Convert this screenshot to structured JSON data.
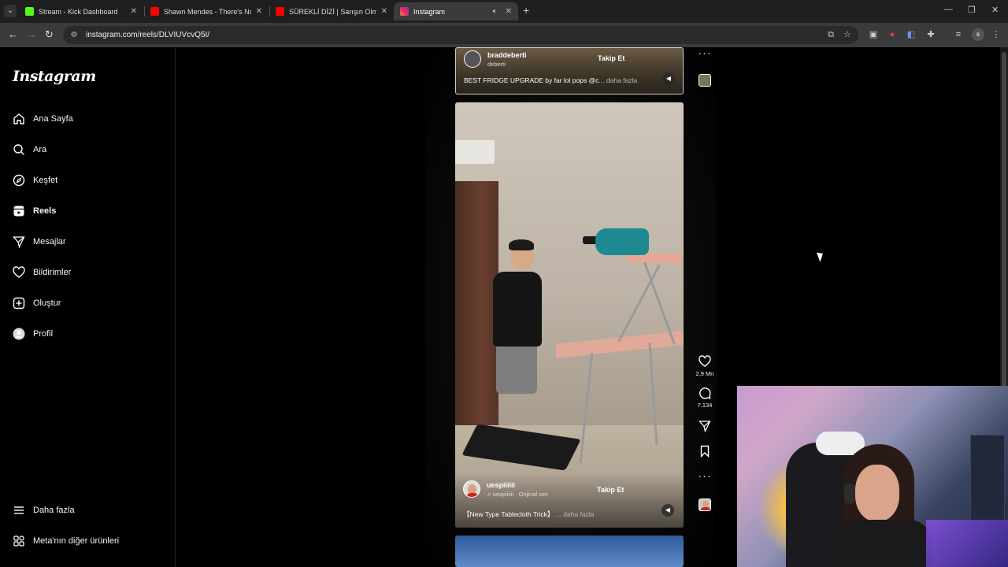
{
  "browser": {
    "tabs": [
      {
        "title": "Stream - Kick Dashboard",
        "favicon_color": "#53fc18",
        "favicon_icon": "kick-icon",
        "active": false
      },
      {
        "title": "Shawn Mendes - There's Nothin",
        "favicon_color": "#ff0000",
        "favicon_icon": "youtube-icon",
        "active": false
      },
      {
        "title": "SÜREKLİ DİZİ | Sarışın Olma İdd",
        "favicon_color": "#ff0000",
        "favicon_icon": "youtube-icon",
        "active": false
      },
      {
        "title": "Instagram",
        "favicon_color": "#d6249f",
        "favicon_icon": "instagram-icon",
        "active": true
      }
    ],
    "new_tab": "+",
    "url": "instagram.com/reels/DLVIUVcvQ5I/",
    "profile_initial": "s"
  },
  "instagram": {
    "logo": "Instagram",
    "nav": [
      {
        "label": "Ana Sayfa",
        "icon": "home-icon"
      },
      {
        "label": "Ara",
        "icon": "search-icon"
      },
      {
        "label": "Keşfet",
        "icon": "compass-icon"
      },
      {
        "label": "Reels",
        "icon": "reels-icon",
        "active": true
      },
      {
        "label": "Mesajlar",
        "icon": "send-icon"
      },
      {
        "label": "Bildirimler",
        "icon": "heart-icon"
      },
      {
        "label": "Oluştur",
        "icon": "plus-square-icon"
      },
      {
        "label": "Profil",
        "icon": "avatar-icon"
      }
    ],
    "bottom_nav": [
      {
        "label": "Daha fazla",
        "icon": "menu-icon"
      },
      {
        "label": "Meta'nın diğer ürünleri",
        "icon": "meta-apps-icon"
      }
    ],
    "reels": [
      {
        "username": "braddeberti",
        "sub": "deberti",
        "follow": "Takip Et",
        "caption": "BEST FRIDGE UPGRADE by far lol pops @c",
        "more": "... daha fazla"
      },
      {
        "username": "uespiiiiii",
        "sub": "uespiiiiii · Orijinal ses",
        "follow": "Takip Et",
        "caption": "【New Type Tablecloth Trick】",
        "more": "... daha fazla",
        "likes": "2,9 Mn",
        "comments": "7.134"
      }
    ]
  }
}
